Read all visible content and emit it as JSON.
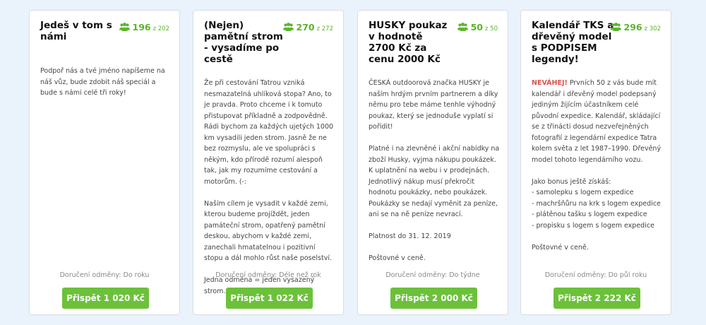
{
  "colors": {
    "accent": "#5ab52c",
    "button": "#6cc13a",
    "background": "#eaf3fb",
    "highlight": "#d9534f"
  },
  "icons": {
    "backers": "users-icon"
  },
  "delivery_prefix": "Doručení odměny:",
  "cards": [
    {
      "title": "Jedeš v tom s námi",
      "count": "196",
      "of": "z 202",
      "paragraphs": [
        "Podpoř nás a tvé jméno napíšeme na náš vůz, bude zdobit náš speciál a bude s námi celé tři roky!"
      ],
      "delivery": "Do roku",
      "button": "Přispět 1 020 Kč"
    },
    {
      "title": "(Nejen) pamětní strom - vysadíme po cestě",
      "count": "270",
      "of": "z 272",
      "paragraphs": [
        "Že při cestování Tatrou vzniká nesmazatelná uhlíková stopa? Ano, to je pravda. Proto chceme i k tomuto přistupovat příkladně a zodpovědně. Rádi bychom za každých ujetých 1000 km vysadili jeden strom. Jasně že ne bez rozmyslu, ale ve spolupráci s někým, kdo přírodě rozumí alespoň tak, jak my rozumíme cestování a motorům. (-:",
        "Naším cílem je vysadit v každé zemi, kterou budeme projíždět, jeden památeční strom, opatřený pamětní deskou, abychom v každé zemi, zanechali hmatatelnou i pozitivní stopu a dál mohlo růst naše poselství.",
        "Jedna odměna = jeden vysazený strom."
      ],
      "delivery": "Déle než rok",
      "button": "Přispět 1 022 Kč"
    },
    {
      "title": "HUSKY poukaz v hodnotě 2700 Kč za cenu 2000 Kč",
      "count": "50",
      "of": "z 50",
      "paragraphs": [
        "ČESKÁ outdoorová značka HUSKY je naším hrdým prvním partnerem a díky němu pro tebe máme tenhle výhodný poukaz, který se jednoduše vyplatí si pořídit!",
        "Platné i na zlevněné i akční nabídky na zboží Husky, vyjma nákupu poukázek. K uplatnění na webu i v prodejnách. Jednotlivý nákup musí překročit hodnotu poukázky, nebo poukázek. Poukázky se nedají vyměnit za peníze, ani se na ně peníze nevrací.",
        "Platnost do 31. 12. 2019",
        "Poštovné v ceně."
      ],
      "delivery": "Do týdne",
      "button": "Přispět 2 000 Kč"
    },
    {
      "title": "Kalendář TKS a dřevěný model s PODPISEM legendy!",
      "count": "296",
      "of": "z 302",
      "highlight": "NEVÁHEJ!",
      "paragraphs": [
        "Prvních 50 z vás bude mít kalendář i dřevěný model podepsaný jediným žijícím účastníkem celé původní expedice. Kalendář, skládající se z třinácti dosud nezveřejněných fotografií z legendární expedice Tatra kolem světa z let 1987–1990. Dřevěný model tohoto legendárního vozu.",
        "Jako bonus ještě získáš:\n- samolepku s logem expedice\n- machršňůru na krk s logem expedice\n- plátěnou tašku s logem expedice\n- propisku s logem s logem expedice",
        "Poštovné v ceně."
      ],
      "delivery": "Do půl roku",
      "button": "Přispět 2 222 Kč"
    }
  ]
}
